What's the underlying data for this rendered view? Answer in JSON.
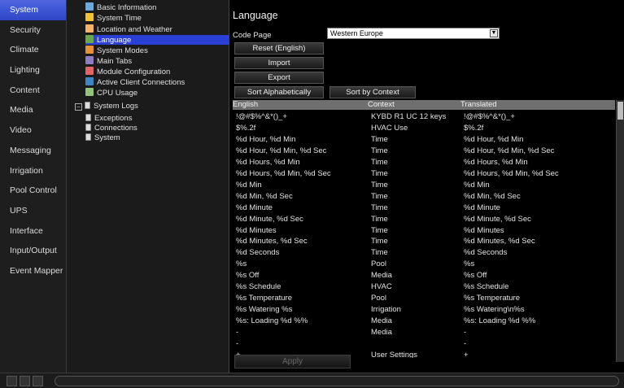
{
  "nav": {
    "items": [
      {
        "label": "System",
        "active": true
      },
      {
        "label": "Security"
      },
      {
        "label": "Climate"
      },
      {
        "label": "Lighting"
      },
      {
        "label": "Content"
      },
      {
        "label": "Media"
      },
      {
        "label": "Video"
      },
      {
        "label": "Messaging"
      },
      {
        "label": "Irrigation"
      },
      {
        "label": "Pool Control"
      },
      {
        "label": "UPS"
      },
      {
        "label": "Interface"
      },
      {
        "label": "Input/Output"
      },
      {
        "label": "Event Mapper"
      }
    ]
  },
  "tree": {
    "items": [
      {
        "label": "Basic Information",
        "icon": "info-panel-icon",
        "color": "#6fa8dc"
      },
      {
        "label": "System Time",
        "icon": "clock-icon",
        "color": "#f1c232"
      },
      {
        "label": "Location and Weather",
        "icon": "weather-icon",
        "color": "#f6b26b"
      },
      {
        "label": "Language",
        "icon": "globe-icon",
        "color": "#6aa84f",
        "selected": true
      },
      {
        "label": "System Modes",
        "icon": "modes-icon",
        "color": "#e69138"
      },
      {
        "label": "Main Tabs",
        "icon": "tabs-icon",
        "color": "#8e7cc3"
      },
      {
        "label": "Module Configuration",
        "icon": "module-icon",
        "color": "#e06666"
      },
      {
        "label": "Active Client Connections",
        "icon": "connections-icon",
        "color": "#3d85c6"
      },
      {
        "label": "CPU Usage",
        "icon": "cpu-icon",
        "color": "#93c47d"
      },
      {
        "label": "System Logs",
        "icon": "log-icon",
        "color": "#cccccc"
      },
      {
        "label": "Exceptions",
        "icon": "log-icon",
        "color": "#cccccc"
      },
      {
        "label": "Connections",
        "icon": "log-icon",
        "color": "#cccccc"
      },
      {
        "label": "System",
        "icon": "log-icon",
        "color": "#cccccc"
      }
    ]
  },
  "main": {
    "title": "Language",
    "code_page_label": "Code Page",
    "code_page_value": "Western Europe",
    "buttons": {
      "reset": "Reset (English)",
      "import": "Import",
      "export": "Export",
      "sort_alpha": "Sort Alphabetically",
      "sort_context": "Sort by Context",
      "apply": "Apply"
    },
    "table": {
      "columns": [
        "English",
        "Context",
        "Translated"
      ],
      "rows": [
        [
          "!@#$%^&*()_+",
          "KYBD R1 UC 12 keys",
          "!@#$%^&*()_+"
        ],
        [
          "$%.2f",
          "HVAC Use",
          "$%.2f"
        ],
        [
          "%d Hour, %d Min",
          "Time",
          "%d Hour, %d Min"
        ],
        [
          "%d Hour, %d Min, %d Sec",
          "Time",
          "%d Hour, %d Min, %d Sec"
        ],
        [
          "%d Hours, %d Min",
          "Time",
          "%d Hours, %d Min"
        ],
        [
          "%d Hours, %d Min, %d Sec",
          "Time",
          "%d Hours, %d Min, %d Sec"
        ],
        [
          "%d Min",
          "Time",
          "%d Min"
        ],
        [
          "%d Min, %d Sec",
          "Time",
          "%d Min, %d Sec"
        ],
        [
          "%d Minute",
          "Time",
          "%d Minute"
        ],
        [
          "%d Minute, %d Sec",
          "Time",
          "%d Minute, %d Sec"
        ],
        [
          "%d Minutes",
          "Time",
          "%d Minutes"
        ],
        [
          "%d Minutes, %d Sec",
          "Time",
          "%d Minutes, %d Sec"
        ],
        [
          "%d Seconds",
          "Time",
          "%d Seconds"
        ],
        [
          "%s",
          "Pool",
          "%s"
        ],
        [
          "%s Off",
          "Media",
          "%s Off"
        ],
        [
          "%s Schedule",
          "HVAC",
          "%s Schedule"
        ],
        [
          "%s Temperature",
          "Pool",
          "%s Temperature"
        ],
        [
          "%s Watering %s",
          "Irrigation",
          "%s Watering\\n%s"
        ],
        [
          "%s: Loading %d %%",
          "Media",
          "%s: Loading %d %%"
        ],
        [
          "-",
          "Media",
          "-"
        ],
        [
          "-",
          "",
          "-"
        ],
        [
          "+",
          "User Settings",
          "+"
        ]
      ]
    }
  }
}
